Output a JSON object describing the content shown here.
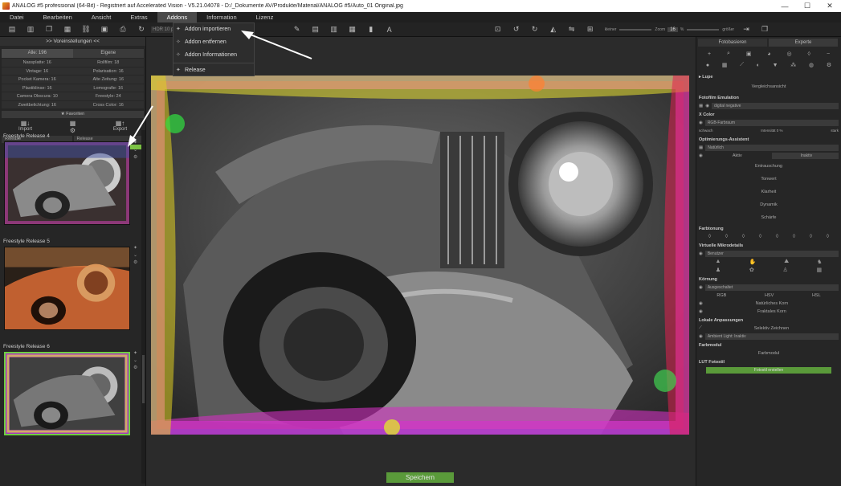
{
  "window": {
    "title": "ANALOG #5 professional (64-Bit) - Registriert auf Accelerated Vision - V5.21.04078 - D:/_Dokumente AV/Produkte/Material/ANALOG #5/Auto_01 Original.jpg",
    "minimize": "—",
    "maximize": "☐",
    "close": "✕"
  },
  "menu": [
    "Datei",
    "Bearbeiten",
    "Ansicht",
    "Extras",
    "Addons",
    "Information",
    "Lizenz"
  ],
  "active_menu": "Addons",
  "toolbar": {
    "hdr_label": "HDR 10 profess",
    "zoom_label": "Zoom",
    "zoom_value": "16",
    "zoom_unit": "%",
    "smaller": "kleiner",
    "larger": "größer"
  },
  "addons_menu": {
    "items": [
      {
        "label": "Addon importieren",
        "icon": "import-icon"
      },
      {
        "label": "Addon entfernen",
        "icon": "remove-icon"
      },
      {
        "label": "Addon Informationen",
        "icon": "info-icon"
      },
      {
        "label": "Release",
        "icon": "release-icon"
      }
    ]
  },
  "left_panel": {
    "title": ">> Voreinstellungen <<",
    "tabs": [
      "Alle: 196",
      "Eigene"
    ],
    "presets": [
      "Nassplatte: 16",
      "Rollfilm: 18",
      "Vintage: 16",
      "Polarisation: 16",
      "Pocket Kamera: 16",
      "Alte Zeitung: 16",
      "Plastiklinse: 16",
      "Lomografie: 16",
      "Camera Obscura: 10",
      "Freestyle: 24",
      "Zweitbelichtung: 16",
      "Cross Color: 16"
    ],
    "favorites": "★ Favoriten",
    "import_label": "Import",
    "export_label": "Export",
    "select_left": "Release",
    "select_right": "Release",
    "thumbnails": [
      "Freestyle Release 4",
      "Freestyle Release 5",
      "Freestyle Release 6"
    ]
  },
  "save_button": "Speichern",
  "right_panel": {
    "tabs": [
      "Fotobasieren",
      "Experte"
    ],
    "lupe": "Lupe",
    "vergleich": "Vergleichsansicht",
    "sections": {
      "fotofilm": "Fotofilm Emulation",
      "fotofilm_value": "digital negative",
      "xcolor": "X Color",
      "xcolor_value": "RGB-Farbraum",
      "xcolor_left": "schwach",
      "xcolor_mid": "Intensität",
      "xcolor_val": "0",
      "xcolor_unit": "%",
      "xcolor_right": "stark",
      "optim": "Optimierungs-Assistent",
      "optim_value": "Natürlich",
      "aktiv": "Aktiv",
      "inaktiv": "Inaktiv",
      "opt_items": [
        "Entrauschung",
        "Tonwert",
        "Klarheit",
        "Dynamik",
        "Schärfe"
      ],
      "farbtonung": "Farbtonung",
      "virtuelle": "Virtuelle Mikrodetails",
      "virtuelle_value": "Benutzer",
      "kornung": "Körnung",
      "kornung_value": "Ausgeschaltet",
      "rgb": "RGB",
      "hsv": "HSV",
      "hsl": "HSL",
      "naturlich": "Natürliches Korn",
      "fraktal": "Fraktales Korn",
      "lokale": "Lokale Anpassungen",
      "selektiv": "Selektiv Zeichnen",
      "ambient": "Ambient Light: Inaktiv",
      "farbmodul": "Farbmodul",
      "farbmodul_btn": "Farbmodul",
      "lut": "LUT Fotostil",
      "lut_btn": "Fotostil erstellen"
    }
  }
}
